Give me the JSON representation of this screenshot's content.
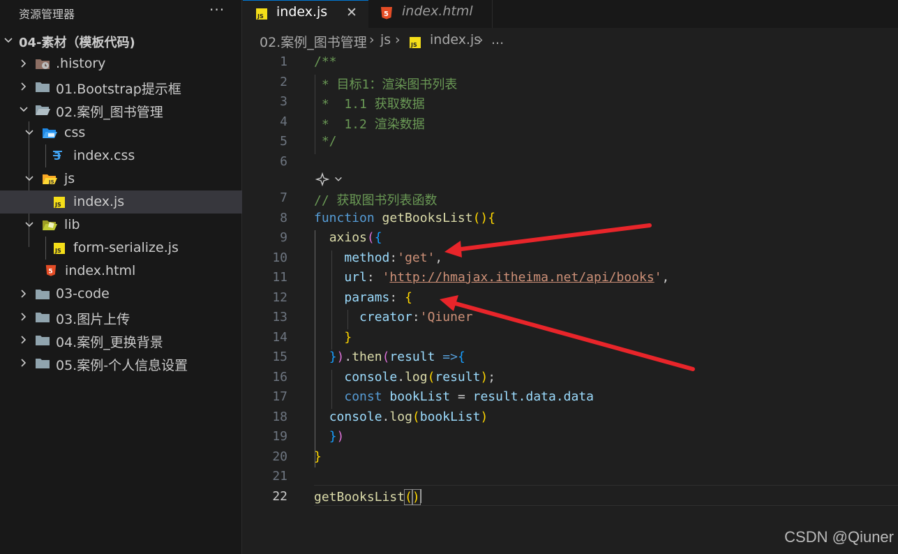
{
  "sidebar": {
    "title": "资源管理器",
    "more_label": "···",
    "items": [
      {
        "label": "04-素材（模板代码)",
        "icon": "chevron-down-icon"
      },
      {
        "label": ".history",
        "icon": "history-folder-icon"
      },
      {
        "label": "01.Bootstrap提示框",
        "icon": "folder-icon"
      },
      {
        "label": "02.案例_图书管理",
        "icon": "folder-open-icon"
      },
      {
        "label": "css",
        "icon": "css-folder-icon"
      },
      {
        "label": "index.css",
        "icon": "css-file-icon"
      },
      {
        "label": "js",
        "icon": "js-folder-icon"
      },
      {
        "label": "index.js",
        "icon": "js-file-icon"
      },
      {
        "label": "lib",
        "icon": "lib-folder-icon"
      },
      {
        "label": "form-serialize.js",
        "icon": "js-file-icon"
      },
      {
        "label": "index.html",
        "icon": "html-file-icon"
      },
      {
        "label": "03-code",
        "icon": "folder-icon"
      },
      {
        "label": "03.图片上传",
        "icon": "folder-icon"
      },
      {
        "label": "04.案例_更换背景",
        "icon": "folder-icon"
      },
      {
        "label": "05.案例-个人信息设置",
        "icon": "folder-icon"
      }
    ]
  },
  "tabs": [
    {
      "label": "index.js",
      "icon_text": "JS",
      "close": "✕"
    },
    {
      "label": "index.html",
      "icon_text": "5"
    }
  ],
  "breadcrumb": {
    "folder": "02.案例_图书管理",
    "sub": "js",
    "file": "index.js",
    "more": "...",
    "sep": "›"
  },
  "editor": {
    "line_numbers": [
      "1",
      "2",
      "3",
      "4",
      "5",
      "6",
      "7",
      "8",
      "9",
      "10",
      "11",
      "12",
      "13",
      "14",
      "15",
      "16",
      "17",
      "18",
      "19",
      "20",
      "21",
      "22"
    ],
    "active_line": "22",
    "code": {
      "l1": "/**",
      "l2": " * 目标1：渲染图书列表",
      "l3": " *  1.1 获取数据",
      "l4": " *  1.2 渲染数据",
      "l5": " */",
      "l7": "// 获取图书列表函数",
      "l8_kw": "function",
      "l8_fn": "getBooksList",
      "l9_fn": "axios",
      "l10_key": "method",
      "l10_val": "'get'",
      "l11_key": "url",
      "l11_q1": "'",
      "l11_url": "http://hmajax.itheima.net/api/books",
      "l11_q2": "'",
      "l12_key": "params",
      "l13_key": "creator",
      "l13_val": "'Qiuner",
      "l15_then": "then",
      "l15_param": "result",
      "l16_obj": "console",
      "l16_fn": "log",
      "l16_arg": "result",
      "l17_kw": "const",
      "l17_var": "bookList",
      "l17_expr": "result.data.data",
      "l18_obj": "console",
      "l18_fn": "log",
      "l18_arg": "bookList",
      "l22_fn": "getBooksList"
    }
  },
  "watermark": "CSDN @Qiuner",
  "colors": {
    "accent": "#0078d4",
    "arrow": "#e8252a",
    "js_icon": "#f5de19",
    "html_icon": "#e44d26",
    "css_icon": "#42a5f5"
  }
}
